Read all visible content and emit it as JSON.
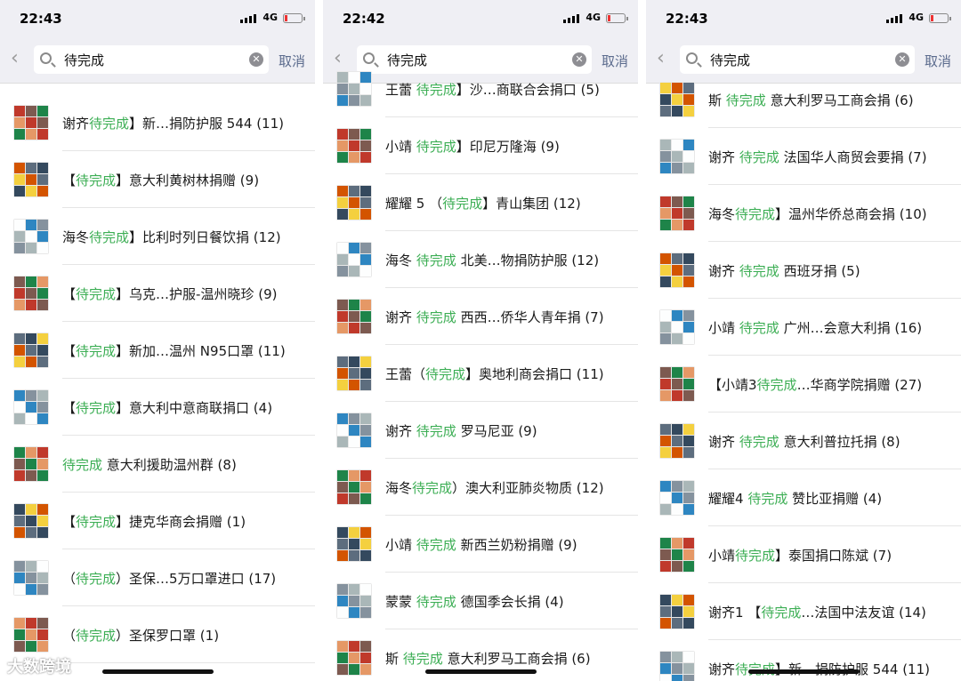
{
  "screens": [
    {
      "time": "22:43",
      "network": "4G",
      "search_value": "待完成",
      "cancel_label": "取消",
      "rows": [
        {
          "pre": "谢齐",
          "hl": "待完成",
          "post": "】新…捐防护服 544 (11)"
        },
        {
          "pre": "【",
          "hl": "待完成",
          "post": "】意大利黄树林捐赠 (9)"
        },
        {
          "pre": "海冬",
          "hl": "待完成",
          "post": "】比利时列日餐饮捐 (12)"
        },
        {
          "pre": "【",
          "hl": "待完成",
          "post": "】乌克…护服-温州晓珍 (9)"
        },
        {
          "pre": "【",
          "hl": "待完成",
          "post": "】新加…温州 N95口罩 (11)"
        },
        {
          "pre": "【",
          "hl": "待完成",
          "post": "】意大利中意商联捐口 (4)"
        },
        {
          "pre": "",
          "hl": "待完成",
          "post": " 意大利援助温州群 (8)"
        },
        {
          "pre": "【",
          "hl": "待完成",
          "post": "】捷克华商会捐赠 (1)"
        },
        {
          "pre": "（",
          "hl": "待完成",
          "post": "）圣保…5万口罩进口 (17)"
        },
        {
          "pre": "（",
          "hl": "待完成",
          "post": "）圣保罗口罩 (1)"
        }
      ]
    },
    {
      "time": "22:42",
      "network": "4G",
      "search_value": "待完成",
      "cancel_label": "取消",
      "rows": [
        {
          "pre": "王蕾 ",
          "hl": "待完成",
          "post": "】沙…商联合会捐口 (5)"
        },
        {
          "pre": "小靖 ",
          "hl": "待完成",
          "post": "】印尼万隆海 (9)"
        },
        {
          "pre": "耀耀 5 （",
          "hl": "待完成",
          "post": "】青山集团 (12)"
        },
        {
          "pre": "海冬 ",
          "hl": "待完成",
          "post": " 北美…物捐防护服 (12)"
        },
        {
          "pre": "谢齐 ",
          "hl": "待完成",
          "post": " 西西…侨华人青年捐 (7)"
        },
        {
          "pre": "王蕾（",
          "hl": "待完成",
          "post": "】奥地利商会捐口 (11)"
        },
        {
          "pre": "谢齐  ",
          "hl": "待完成",
          "post": " 罗马尼亚 (9)"
        },
        {
          "pre": "海冬",
          "hl": "待完成",
          "post": "）澳大利亚肺炎物质 (12)"
        },
        {
          "pre": "小靖 ",
          "hl": "待完成",
          "post": " 新西兰奶粉捐赠 (9)"
        },
        {
          "pre": "蒙蒙 ",
          "hl": "待完成",
          "post": " 德国季会长捐 (4)"
        },
        {
          "pre": "斯 ",
          "hl": "待完成",
          "post": " 意大利罗马工商会捐 (6)"
        }
      ]
    },
    {
      "time": "22:43",
      "network": "4G",
      "search_value": "待完成",
      "cancel_label": "取消",
      "rows": [
        {
          "pre": "斯 ",
          "hl": "待完成",
          "post": " 意大利罗马工商会捐 (6)"
        },
        {
          "pre": "谢齐 ",
          "hl": "待完成",
          "post": " 法国华人商贸会要捐 (7)"
        },
        {
          "pre": "海冬",
          "hl": "待完成",
          "post": "】温州华侨总商会捐 (10)"
        },
        {
          "pre": "谢齐 ",
          "hl": "待完成",
          "post": " 西班牙捐 (5)"
        },
        {
          "pre": "小靖 ",
          "hl": "待完成",
          "post": " 广州…会意大利捐 (16)"
        },
        {
          "pre": "【小靖3",
          "hl": "待完成",
          "post": "…华商学院捐赠 (27)"
        },
        {
          "pre": "谢齐 ",
          "hl": "待完成",
          "post": " 意大利普拉托捐 (8)"
        },
        {
          "pre": "耀耀4 ",
          "hl": "待完成",
          "post": " 赞比亚捐赠 (4)"
        },
        {
          "pre": "小靖",
          "hl": "待完成",
          "post": "】泰国捐口陈斌 (7)"
        },
        {
          "pre": "谢齐1 【",
          "hl": "待完成",
          "post": "…法国中法友谊 (14)"
        },
        {
          "pre": "谢齐",
          "hl": "待完成",
          "post": "】新…捐防护服 544 (11)"
        }
      ]
    }
  ],
  "watermark": "大数跨境",
  "colors": {
    "highlight": "#3cae54",
    "cancel": "#5b6b8d",
    "header_bg": "#efeff4"
  }
}
